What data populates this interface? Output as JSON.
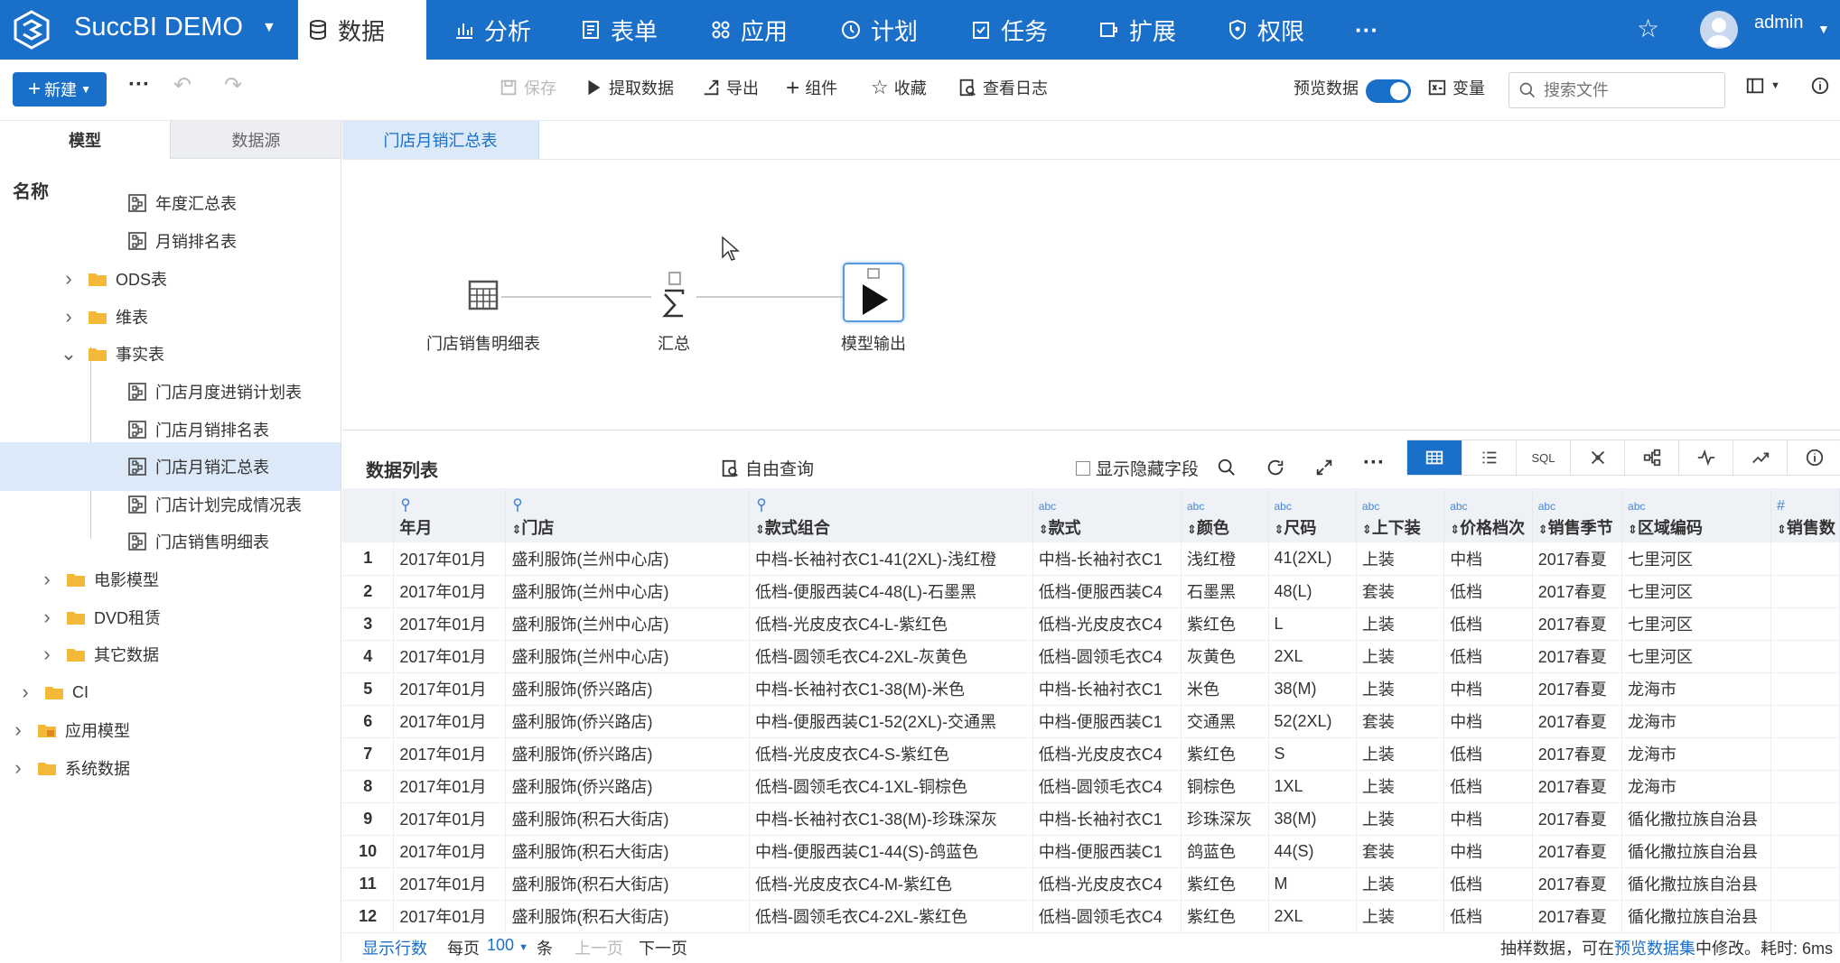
{
  "app": {
    "brand": "SuccBI DEMO",
    "user": "admin"
  },
  "nav": {
    "tabs": [
      {
        "label": "数据",
        "icon": "database-icon",
        "active": true
      },
      {
        "label": "分析",
        "icon": "bar-chart-icon"
      },
      {
        "label": "表单",
        "icon": "form-icon"
      },
      {
        "label": "应用",
        "icon": "apps-icon"
      },
      {
        "label": "计划",
        "icon": "clock-icon"
      },
      {
        "label": "任务",
        "icon": "task-icon"
      },
      {
        "label": "扩展",
        "icon": "extension-icon"
      },
      {
        "label": "权限",
        "icon": "shield-icon"
      }
    ],
    "more": "···"
  },
  "toolbar": {
    "new_label": "新建",
    "save": "保存",
    "extract": "提取数据",
    "export": "导出",
    "component": "组件",
    "favorite": "收藏",
    "log": "查看日志",
    "preview_label": "预览数据",
    "variables": "变量",
    "search_placeholder": "搜索文件"
  },
  "left": {
    "tab_model": "模型",
    "tab_datasource": "数据源",
    "name_header": "名称",
    "tree": [
      {
        "label": "年度汇总表",
        "type": "model"
      },
      {
        "label": "月销排名表",
        "type": "model"
      },
      {
        "label": "ODS表",
        "type": "folder"
      },
      {
        "label": "维表",
        "type": "folder"
      },
      {
        "label": "事实表",
        "type": "folder"
      },
      {
        "label": "门店月度进销计划表",
        "type": "model"
      },
      {
        "label": "门店月销排名表",
        "type": "model"
      },
      {
        "label": "门店月销汇总表",
        "type": "model",
        "selected": true
      },
      {
        "label": "门店计划完成情况表",
        "type": "model"
      },
      {
        "label": "门店销售明细表",
        "type": "model"
      },
      {
        "label": "电影模型",
        "type": "folder"
      },
      {
        "label": "DVD租赁",
        "type": "folder"
      },
      {
        "label": "其它数据",
        "type": "folder"
      },
      {
        "label": "CI",
        "type": "folder"
      },
      {
        "label": "应用模型",
        "type": "folder"
      },
      {
        "label": "系统数据",
        "type": "folder"
      }
    ]
  },
  "doc_tab": "门店月销汇总表",
  "flow": {
    "nodes": [
      {
        "label": "门店销售明细表",
        "icon": "table-grid-icon"
      },
      {
        "label": "汇总",
        "icon": "sigma-icon"
      },
      {
        "label": "模型输出",
        "icon": "output-play-icon"
      }
    ]
  },
  "datalist": {
    "title": "数据列表",
    "free_query": "自由查询",
    "show_hidden": "显示隐藏字段",
    "view_sql": "SQL",
    "columns": [
      {
        "name": "年月",
        "type": "dim"
      },
      {
        "name": "门店",
        "type": "dim"
      },
      {
        "name": "款式组合",
        "type": "dim"
      },
      {
        "name": "款式",
        "type": "abc"
      },
      {
        "name": "颜色",
        "type": "abc"
      },
      {
        "name": "尺码",
        "type": "abc"
      },
      {
        "name": "上下装",
        "type": "abc"
      },
      {
        "name": "价格档次",
        "type": "abc"
      },
      {
        "name": "销售季节",
        "type": "abc"
      },
      {
        "name": "区域编码",
        "type": "abc"
      },
      {
        "name": "销售数",
        "type": "#"
      }
    ],
    "type_labels": {
      "abc": "abc",
      "#": "#"
    },
    "rows": [
      [
        "1",
        "2017年01月",
        "盛利服饰(兰州中心店)",
        "中档-长袖衬衣C1-41(2XL)-浅红橙",
        "中档-长袖衬衣C1",
        "浅红橙",
        "41(2XL)",
        "上装",
        "中档",
        "2017春夏",
        "七里河区"
      ],
      [
        "2",
        "2017年01月",
        "盛利服饰(兰州中心店)",
        "低档-便服西装C4-48(L)-石墨黑",
        "低档-便服西装C4",
        "石墨黑",
        "48(L)",
        "套装",
        "低档",
        "2017春夏",
        "七里河区"
      ],
      [
        "3",
        "2017年01月",
        "盛利服饰(兰州中心店)",
        "低档-光皮皮衣C4-L-紫红色",
        "低档-光皮皮衣C4",
        "紫红色",
        "L",
        "上装",
        "低档",
        "2017春夏",
        "七里河区"
      ],
      [
        "4",
        "2017年01月",
        "盛利服饰(兰州中心店)",
        "低档-圆领毛衣C4-2XL-灰黄色",
        "低档-圆领毛衣C4",
        "灰黄色",
        "2XL",
        "上装",
        "低档",
        "2017春夏",
        "七里河区"
      ],
      [
        "5",
        "2017年01月",
        "盛利服饰(侨兴路店)",
        "中档-长袖衬衣C1-38(M)-米色",
        "中档-长袖衬衣C1",
        "米色",
        "38(M)",
        "上装",
        "中档",
        "2017春夏",
        "龙海市"
      ],
      [
        "6",
        "2017年01月",
        "盛利服饰(侨兴路店)",
        "中档-便服西装C1-52(2XL)-交通黑",
        "中档-便服西装C1",
        "交通黑",
        "52(2XL)",
        "套装",
        "中档",
        "2017春夏",
        "龙海市"
      ],
      [
        "7",
        "2017年01月",
        "盛利服饰(侨兴路店)",
        "低档-光皮皮衣C4-S-紫红色",
        "低档-光皮皮衣C4",
        "紫红色",
        "S",
        "上装",
        "低档",
        "2017春夏",
        "龙海市"
      ],
      [
        "8",
        "2017年01月",
        "盛利服饰(侨兴路店)",
        "低档-圆领毛衣C4-1XL-铜棕色",
        "低档-圆领毛衣C4",
        "铜棕色",
        "1XL",
        "上装",
        "低档",
        "2017春夏",
        "龙海市"
      ],
      [
        "9",
        "2017年01月",
        "盛利服饰(积石大街店)",
        "中档-长袖衬衣C1-38(M)-珍珠深灰",
        "中档-长袖衬衣C1",
        "珍珠深灰",
        "38(M)",
        "上装",
        "中档",
        "2017春夏",
        "循化撒拉族自治县"
      ],
      [
        "10",
        "2017年01月",
        "盛利服饰(积石大街店)",
        "中档-便服西装C1-44(S)-鸽蓝色",
        "中档-便服西装C1",
        "鸽蓝色",
        "44(S)",
        "套装",
        "中档",
        "2017春夏",
        "循化撒拉族自治县"
      ],
      [
        "11",
        "2017年01月",
        "盛利服饰(积石大街店)",
        "低档-光皮皮衣C4-M-紫红色",
        "低档-光皮皮衣C4",
        "紫红色",
        "M",
        "上装",
        "低档",
        "2017春夏",
        "循化撒拉族自治县"
      ],
      [
        "12",
        "2017年01月",
        "盛利服饰(积石大街店)",
        "低档-圆领毛衣C4-2XL-紫红色",
        "低档-圆领毛衣C4",
        "紫红色",
        "2XL",
        "上装",
        "低档",
        "2017春夏",
        "循化撒拉族自治县"
      ]
    ]
  },
  "footer": {
    "show_rows": "显示行数",
    "per_page": "每页",
    "page_size": "100",
    "unit": "条",
    "prev": "上一页",
    "next": "下一页",
    "note_prefix": "抽样数据，可在",
    "note_link": "预览数据集",
    "note_suffix": "中修改。耗时: 6ms"
  },
  "colors": {
    "primary": "#1a6fc9",
    "selected_bg": "#dce9f8",
    "folder": "#f5b93a"
  }
}
